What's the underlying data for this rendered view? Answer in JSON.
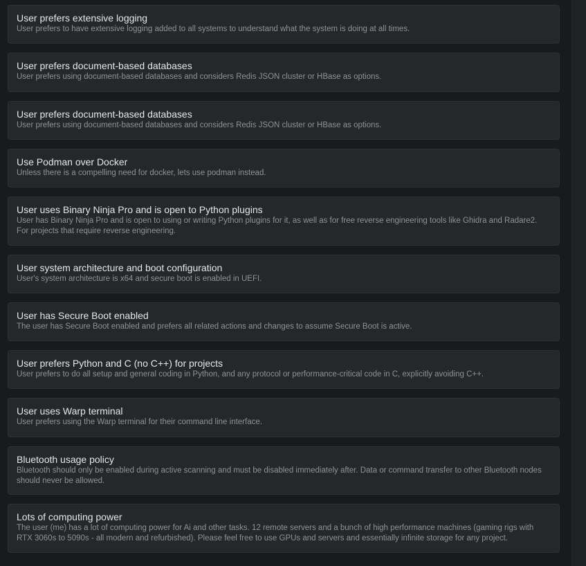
{
  "memories": [
    {
      "title": "User prefers extensive logging",
      "description": "User prefers to have extensive logging added to all systems to understand what the system is doing at all times."
    },
    {
      "title": "User prefers document-based databases",
      "description": "User prefers using document-based databases and considers Redis JSON cluster or HBase as options."
    },
    {
      "title": "User prefers document-based databases",
      "description": "User prefers using document-based databases and considers Redis JSON cluster or HBase as options."
    },
    {
      "title": "Use Podman over Docker",
      "description": "Unless there is a compelling need for docker, lets use podman instead."
    },
    {
      "title": "User uses Binary Ninja Pro and is open to Python plugins",
      "description": "User has Binary Ninja Pro and is open to using or writing Python plugins for it, as well as for free reverse engineering tools like Ghidra and Radare2. For projects that require reverse engineering."
    },
    {
      "title": "User system architecture and boot configuration",
      "description": "User's system architecture is x64 and secure boot is enabled in UEFI."
    },
    {
      "title": "User has Secure Boot enabled",
      "description": "The user has Secure Boot enabled and prefers all related actions and changes to assume Secure Boot is active."
    },
    {
      "title": "User prefers Python and C (no C++) for projects",
      "description": "User prefers to do all setup and general coding in Python, and any protocol or performance-critical code in C, explicitly avoiding C++."
    },
    {
      "title": "User uses Warp terminal",
      "description": "User prefers using the Warp terminal for their command line interface."
    },
    {
      "title": "Bluetooth usage policy",
      "description": "Bluetooth should only be enabled during active scanning and must be disabled immediately after. Data or command transfer to other Bluetooth nodes should never be allowed."
    },
    {
      "title": "Lots of computing power",
      "description": "The user (me) has a lot of computing power for Ai and other tasks. 12 remote servers and a bunch of high performance machines (gaming rigs with RTX 3060s to 5090s - all modern and refurbished). Please feel free to use GPUs and servers and essentially infinite storage for any project."
    }
  ]
}
